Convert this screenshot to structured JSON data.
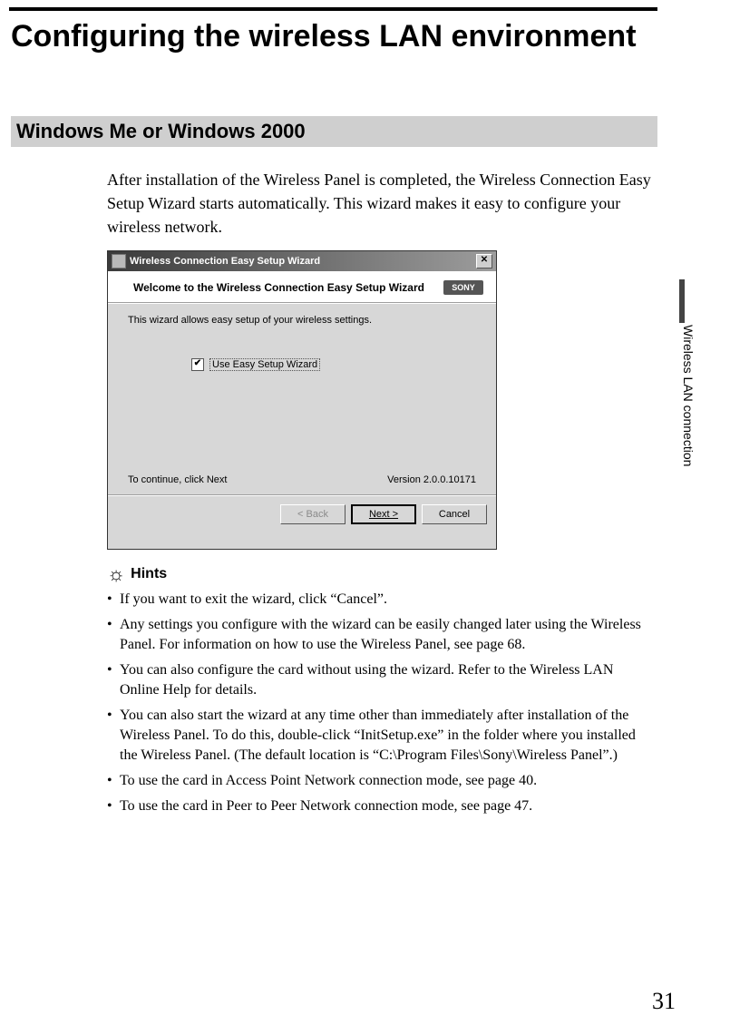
{
  "header": {
    "title": "Configuring the wireless LAN environment"
  },
  "section": {
    "bar": "Windows Me or Windows 2000",
    "intro": "After installation of the Wireless Panel is completed, the Wireless Connection Easy Setup Wizard starts automatically. This wizard makes it easy to configure your wireless network."
  },
  "wizard": {
    "titlebar": "Wireless Connection Easy Setup Wizard",
    "close_glyph": "✕",
    "welcome": "Welcome to the Wireless Connection Easy Setup Wizard",
    "brand": "SONY",
    "desc": "This wizard allows easy setup of your wireless settings.",
    "check_mark": "✔",
    "checkbox_label": "Use Easy Setup Wizard",
    "continue_text": "To continue, click Next",
    "version": "Version 2.0.0.10171",
    "buttons": {
      "back": "< Back",
      "next": "Next >",
      "cancel": "Cancel"
    }
  },
  "hints": {
    "icon": "☼",
    "label": "Hints",
    "items": [
      "If you want to exit the wizard, click “Cancel”.",
      "Any settings you configure with the wizard can be easily changed later using the Wireless Panel. For information on how to use the Wireless Panel, see page 68.",
      "You can also configure the card without using the wizard. Refer to the Wireless LAN Online Help for details.",
      "You can also start the wizard at any time other than immediately after installation of the Wireless Panel. To do this, double-click “InitSetup.exe” in the folder where you installed the Wireless Panel. (The default location is “C:\\Program Files\\Sony\\Wireless Panel”.)",
      "To use the card in Access Point Network connection mode, see page 40.",
      "To use the card in Peer to Peer Network connection mode, see page 47."
    ],
    "bullet": "•"
  },
  "side_tab": "Wireless LAN connection",
  "page_number": "31"
}
